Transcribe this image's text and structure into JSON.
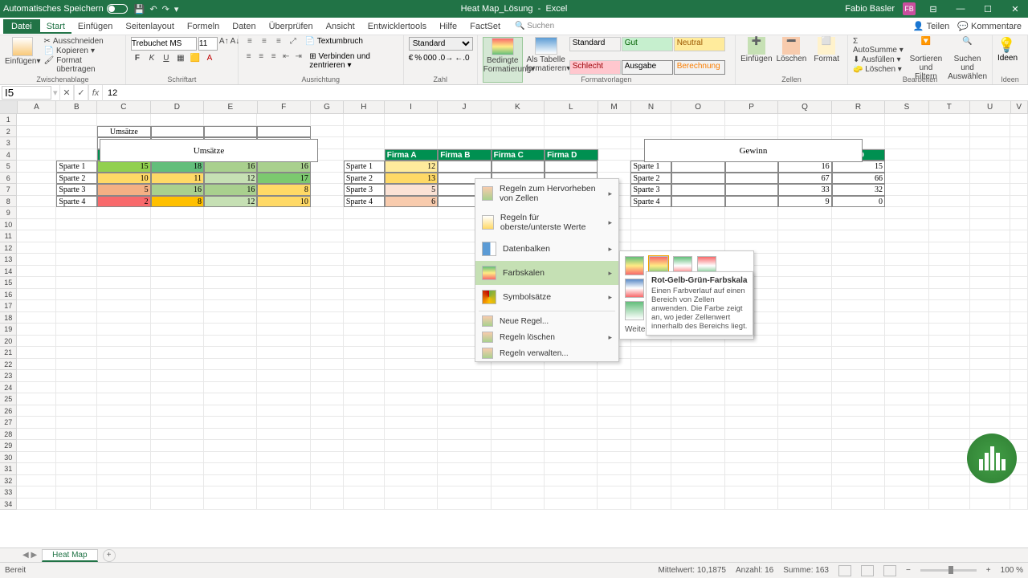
{
  "titlebar": {
    "autosave": "Automatisches Speichern",
    "doc": "Heat Map_Lösung",
    "app": "Excel",
    "user": "Fabio Basler",
    "initials": "FB"
  },
  "tabs": {
    "file": "Datei",
    "items": [
      "Start",
      "Einfügen",
      "Seitenlayout",
      "Formeln",
      "Daten",
      "Überprüfen",
      "Ansicht",
      "Entwicklertools",
      "Hilfe",
      "FactSet"
    ],
    "active": "Start",
    "search": "Suchen",
    "share": "Teilen",
    "comments": "Kommentare"
  },
  "ribbon": {
    "paste": "Einfügen",
    "cut": "Ausschneiden",
    "copy": "Kopieren",
    "format_painter": "Format übertragen",
    "g_clip": "Zwischenablage",
    "font_name": "Trebuchet MS",
    "font_size": "11",
    "g_font": "Schriftart",
    "wrap": "Textumbruch",
    "merge": "Verbinden und zentrieren",
    "g_align": "Ausrichtung",
    "numfmt": "Standard",
    "g_num": "Zahl",
    "cond": "Bedingte Formatierung",
    "as_table": "Als Tabelle formatieren",
    "styles": {
      "s1": "Standard",
      "s2": "Gut",
      "s3": "Neutral",
      "s4": "Schlecht",
      "s5": "Ausgabe",
      "s6": "Berechnung"
    },
    "g_styles": "Formatvorlagen",
    "insert": "Einfügen",
    "delete": "Löschen",
    "format": "Format",
    "g_cells": "Zellen",
    "sum": "AutoSumme",
    "fill": "Ausfüllen",
    "clear": "Löschen",
    "sort": "Sortieren und Filtern",
    "find": "Suchen und Auswählen",
    "ideas": "Ideen",
    "g_edit": "Bearbeiten",
    "g_ideas": "Ideen"
  },
  "fbar": {
    "name": "I5",
    "value": "12"
  },
  "columns": [
    "A",
    "B",
    "C",
    "D",
    "E",
    "F",
    "G",
    "H",
    "I",
    "J",
    "K",
    "L",
    "M",
    "N",
    "O",
    "P",
    "Q",
    "R",
    "S",
    "T",
    "U",
    "V"
  ],
  "table_headers": {
    "umsatze": "Umsätze",
    "gewinn": "Gewinn"
  },
  "firms": [
    "Firma A",
    "Firma B",
    "Firma C",
    "Firma D"
  ],
  "spartes": [
    "Sparte 1",
    "Sparte 2",
    "Sparte 3",
    "Sparte 4"
  ],
  "t1": [
    [
      15,
      18,
      16,
      16
    ],
    [
      10,
      11,
      12,
      17
    ],
    [
      5,
      16,
      16,
      8
    ],
    [
      2,
      8,
      12,
      10
    ]
  ],
  "t2": [
    [
      12,
      "",
      "",
      ""
    ],
    [
      13,
      "",
      "",
      ""
    ],
    [
      5,
      "",
      "",
      ""
    ],
    [
      6,
      "",
      "",
      ""
    ]
  ],
  "t3": [
    [
      "",
      "",
      16,
      15
    ],
    [
      "",
      "",
      67,
      66
    ],
    [
      "",
      "",
      33,
      32
    ],
    [
      "",
      "",
      9,
      0
    ]
  ],
  "t1_colors": [
    [
      "#92d050",
      "#63be7b",
      "#a9d08e",
      "#a9d08e"
    ],
    [
      "#ffd966",
      "#ffd966",
      "#c6e0b4",
      "#7cc96f"
    ],
    [
      "#f4b084",
      "#a9d08e",
      "#a9d08e",
      "#ffd966"
    ],
    [
      "#f8696b",
      "#ffc000",
      "#c6e0b4",
      "#ffd966"
    ]
  ],
  "t2_colors": [
    [
      "#ffeb9c",
      "",
      "",
      ""
    ],
    [
      "#ffd966",
      "",
      "",
      ""
    ],
    [
      "#fbe2d5",
      "",
      "",
      ""
    ],
    [
      "#f8cbad",
      "",
      "",
      ""
    ]
  ],
  "cfmenu": {
    "i1": "Regeln zum Hervorheben von Zellen",
    "i2": "Regeln für oberste/unterste Werte",
    "i3": "Datenbalken",
    "i4": "Farbskalen",
    "i5": "Symbolsätze",
    "new": "Neue Regel...",
    "clear": "Regeln löschen",
    "manage": "Regeln verwalten..."
  },
  "tooltip": {
    "title": "Rot-Gelb-Grün-Farbskala",
    "body": "Einen Farbverlauf auf einen Bereich von Zellen anwenden. Die Farbe zeigt an, wo jeder Zellenwert innerhalb des Bereichs liegt."
  },
  "more_rules": "Weitere Regeln...",
  "sheettab": "Heat Map",
  "status": {
    "ready": "Bereit",
    "avg": "Mittelwert: 10,1875",
    "count": "Anzahl: 16",
    "sum": "Summe: 163",
    "zoom": "100 %"
  }
}
